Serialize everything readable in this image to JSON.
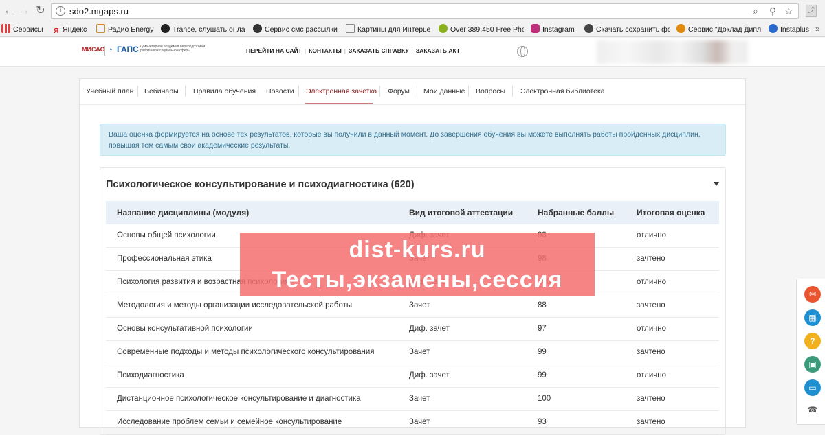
{
  "browser": {
    "url": "sdo2.mgaps.ru",
    "bookmarks": [
      {
        "label": "Сервисы",
        "icon": "apps-grid-icon",
        "color": "#e04040"
      },
      {
        "label": "Яндекс",
        "icon": "yandex-icon",
        "color": "#e02020"
      },
      {
        "label": "Радио Energy",
        "icon": "radio-icon",
        "color": "#d08a30"
      },
      {
        "label": "Trance, слушать онла",
        "icon": "play-icon",
        "color": "#222222"
      },
      {
        "label": "Сервис смс рассылки |",
        "icon": "sms-icon",
        "color": "#333333"
      },
      {
        "label": "Картины для Интерье",
        "icon": "thumb-icon",
        "color": "#888888"
      },
      {
        "label": "Over 389,450 Free Pho",
        "icon": "photo-icon",
        "color": "#8ab020"
      },
      {
        "label": "Instagram",
        "icon": "instagram-icon",
        "color": "#c0307a"
      },
      {
        "label": "Скачать сохранить фо",
        "icon": "eye-icon",
        "color": "#444444"
      },
      {
        "label": "Сервис \"Доклад Дипл",
        "icon": "doc-service-icon",
        "color": "#e08a10"
      },
      {
        "label": "Instaplus",
        "icon": "instaplus-icon",
        "color": "#2a6acc"
      }
    ]
  },
  "site": {
    "logo_miso": "МИСАО",
    "logo_gaps": "ГАПС",
    "logo_subtitle": "Гуманитарная академия переподготовки работников социальной сферы",
    "topnav": [
      "ПЕРЕЙТИ НА САЙТ",
      "КОНТАКТЫ",
      "ЗАКАЗАТЬ СПРАВКУ",
      "ЗАКАЗАТЬ АКТ"
    ]
  },
  "tabs": [
    {
      "label": "Учебный план"
    },
    {
      "label": "Вебинары"
    },
    {
      "label": "Правила обучения"
    },
    {
      "label": "Новости"
    },
    {
      "label": "Электронная зачетка",
      "active": true
    },
    {
      "label": "Форум"
    },
    {
      "label": "Мои данные"
    },
    {
      "label": "Вопросы"
    },
    {
      "label": "Электронная библиотека"
    }
  ],
  "alert": {
    "text": "Ваша оценка формируется на основе тех результатов, которые вы получили в данный момент. До завершения обучения вы можете выполнять работы пройденных дисциплин, повышая тем самым свои академические результаты."
  },
  "program": {
    "title": "Психологическое консультирование и психодиагностика (620)",
    "columns": [
      "Название дисциплины (модуля)",
      "Вид итоговой аттестации",
      "Набранные баллы",
      "Итоговая оценка"
    ],
    "rows": [
      {
        "name": "Основы общей психологии",
        "type": "Диф. зачет",
        "score": "93",
        "grade": "отлично"
      },
      {
        "name": "Профессиональная этика",
        "type": "Зачет",
        "score": "98",
        "grade": "зачтено"
      },
      {
        "name": "Психология развития и возрастная психология",
        "type": "Диф. зачет",
        "score": "100",
        "grade": "отлично"
      },
      {
        "name": "Методология и методы организации исследовательской работы",
        "type": "Зачет",
        "score": "88",
        "grade": "зачтено"
      },
      {
        "name": "Основы консультативной психологии",
        "type": "Диф. зачет",
        "score": "97",
        "grade": "отлично"
      },
      {
        "name": "Современные подходы и методы психологического консультирования",
        "type": "Зачет",
        "score": "99",
        "grade": "зачтено"
      },
      {
        "name": "Психодиагностика",
        "type": "Диф. зачет",
        "score": "99",
        "grade": "отлично"
      },
      {
        "name": "Дистанционное психологическое консультирование и диагностика",
        "type": "Зачет",
        "score": "100",
        "grade": "зачтено"
      },
      {
        "name": "Исследование проблем семьи и семейное консультирование",
        "type": "Зачет",
        "score": "93",
        "grade": "зачтено"
      }
    ]
  },
  "watermark": {
    "line1": "dist-kurs.ru",
    "line2": "Тесты,экзамены,сессия"
  },
  "side_widgets": [
    {
      "icon": "envelope-icon",
      "color": "#e8552e"
    },
    {
      "icon": "calculator-icon",
      "color": "#1e8fd0"
    },
    {
      "icon": "question-icon",
      "color": "#f0b020"
    },
    {
      "icon": "certificate-icon",
      "color": "#3a9a7a"
    },
    {
      "icon": "chat-icon",
      "color": "#1e8fd0"
    },
    {
      "icon": "support-icon",
      "color": "#666666"
    }
  ]
}
